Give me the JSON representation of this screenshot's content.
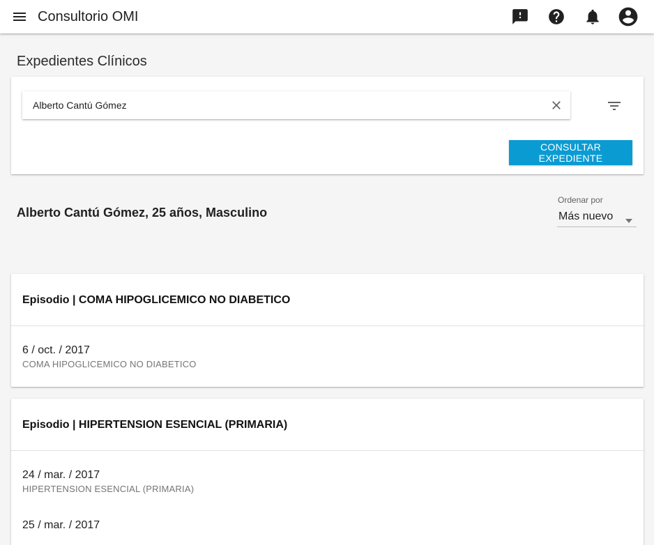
{
  "appbar": {
    "title": "Consultorio OMI",
    "icons": [
      "menu-icon",
      "feedback-icon",
      "help-icon",
      "notifications-icon",
      "account-circle-icon"
    ]
  },
  "page": {
    "title": "Expedientes Clínicos"
  },
  "search": {
    "value": "Alberto Cantú Gómez",
    "button_label": "CONSULTAR EXPEDIENTE",
    "accent_color": "#0b9bd3"
  },
  "patient": {
    "heading": "Alberto Cantú Gómez, 25 años, Masculino"
  },
  "sort": {
    "label": "Ordenar por",
    "selected": "Más nuevo"
  },
  "episodes": [
    {
      "title": "Episodio | COMA HIPOGLICEMICO NO DIABETICO",
      "entries": [
        {
          "date": "6 / oct. / 2017",
          "description": "COMA HIPOGLICEMICO NO DIABETICO"
        }
      ]
    },
    {
      "title": "Episodio | HIPERTENSION ESENCIAL (PRIMARIA)",
      "entries": [
        {
          "date": "24 / mar. / 2017",
          "description": "HIPERTENSION ESENCIAL (PRIMARIA)"
        },
        {
          "date": "25 / mar. / 2017",
          "description": ""
        }
      ]
    }
  ]
}
